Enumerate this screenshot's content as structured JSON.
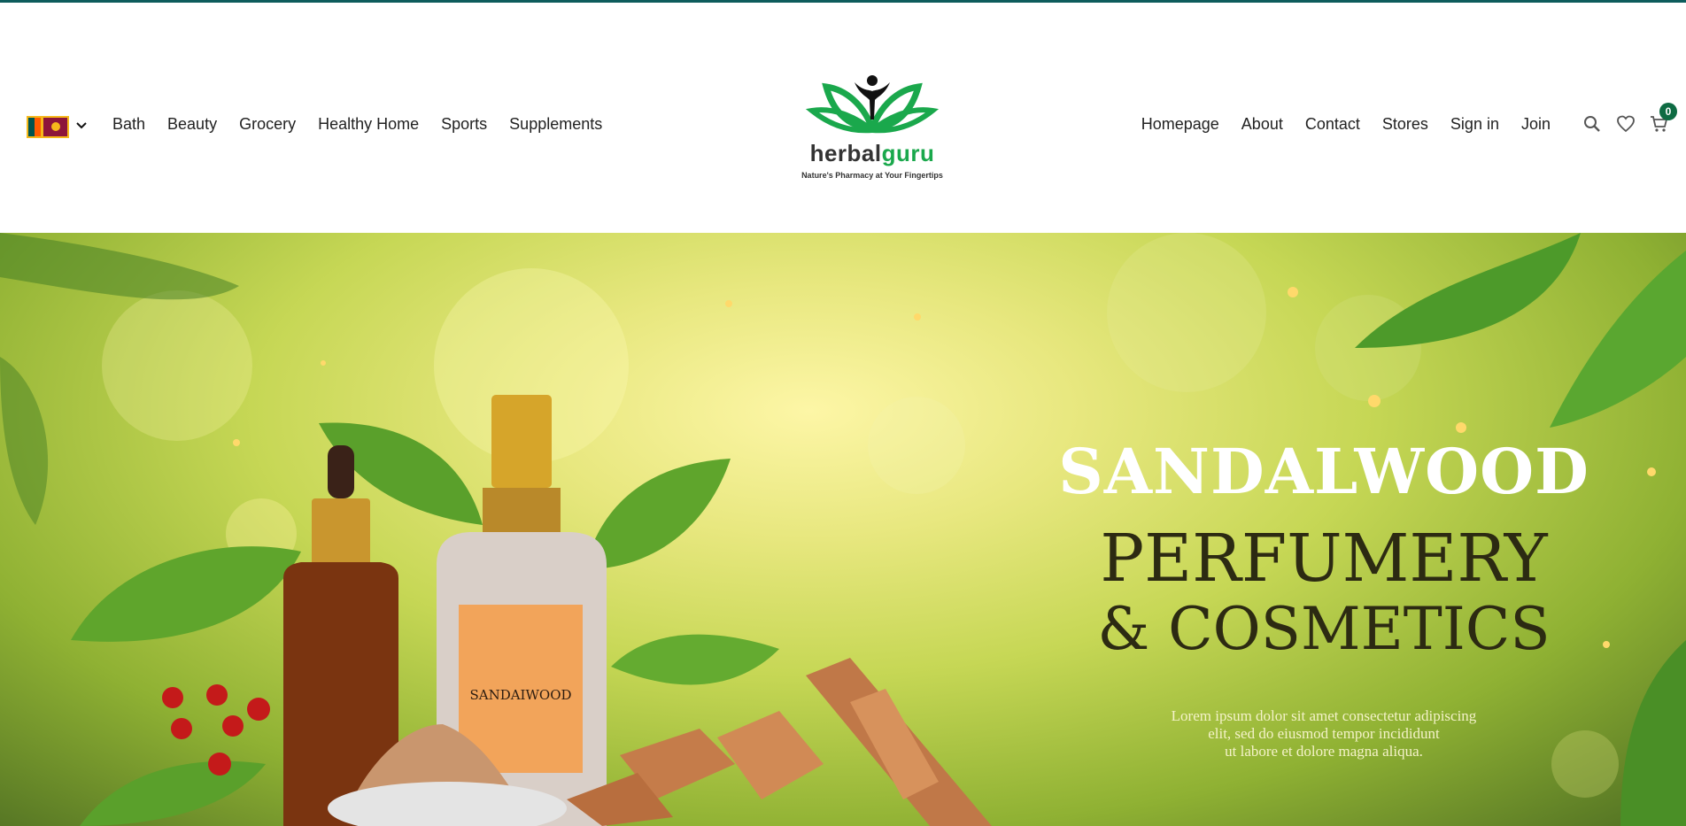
{
  "header": {
    "country_flag": "sri-lanka-flag-icon",
    "left_nav": [
      "Bath",
      "Beauty",
      "Grocery",
      "Healthy Home",
      "Sports",
      "Supplements"
    ],
    "right_nav": [
      "Homepage",
      "About",
      "Contact",
      "Stores",
      "Sign in",
      "Join"
    ],
    "cart_count": "0",
    "logo": {
      "word1": "herbal",
      "word2": "guru",
      "tagline": "Nature's Pharmacy at Your Fingertips"
    },
    "colors": {
      "top_rule": "#0d5c5c",
      "brand_green": "#1aa84c",
      "badge": "#0e6b43"
    }
  },
  "hero": {
    "title_line1": "SANDALWOOD",
    "title_line2": "PERFUMERY",
    "title_line3": "& COSMETICS",
    "body_lines": [
      "Lorem ipsum dolor sit amet  consectetur adipiscing",
      "elit, sed do eiusmod tempor incididunt",
      "ut labore et dolore magna aliqua."
    ],
    "bottle_label": "SANDAIWOOD"
  }
}
